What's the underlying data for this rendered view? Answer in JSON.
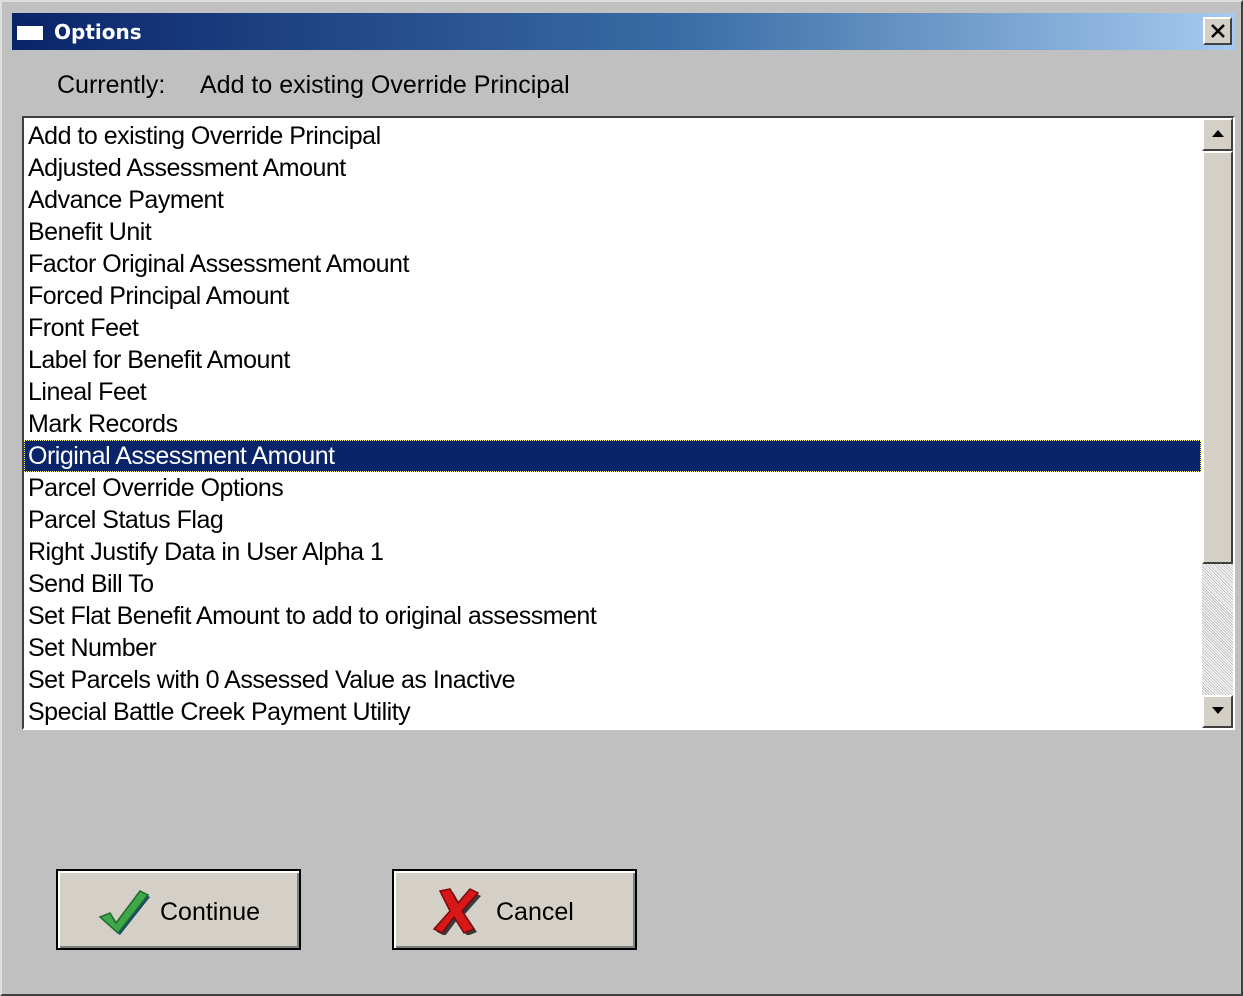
{
  "window": {
    "title": "Options",
    "close_icon": "close-icon"
  },
  "currently": {
    "label": "Currently:",
    "value": "Add to existing Override Principal"
  },
  "options_list": {
    "selected_index": 10,
    "items": [
      "Add to existing Override Principal",
      "Adjusted Assessment Amount",
      "Advance Payment",
      "Benefit Unit",
      "Factor Original Assessment Amount",
      "Forced Principal Amount",
      "Front Feet",
      "Label for Benefit Amount",
      "Lineal Feet",
      "Mark Records",
      "Original Assessment Amount",
      "Parcel Override Options",
      "Parcel Status Flag",
      "Right Justify Data in User Alpha 1",
      "Send Bill To",
      "Set Flat Benefit Amount to add to original assessment",
      "Set Number",
      "Set Parcels with 0 Assessed Value as Inactive",
      "Special Battle Creek Payment Utility"
    ]
  },
  "buttons": {
    "continue": {
      "label": "Continue",
      "icon": "checkmark-icon"
    },
    "cancel": {
      "label": "Cancel",
      "icon": "red-x-icon"
    }
  },
  "colors": {
    "selection": "#0a246a",
    "dialog_background": "#c0c0c0",
    "check_green": "#3fa64a",
    "cancel_red": "#d81818"
  }
}
